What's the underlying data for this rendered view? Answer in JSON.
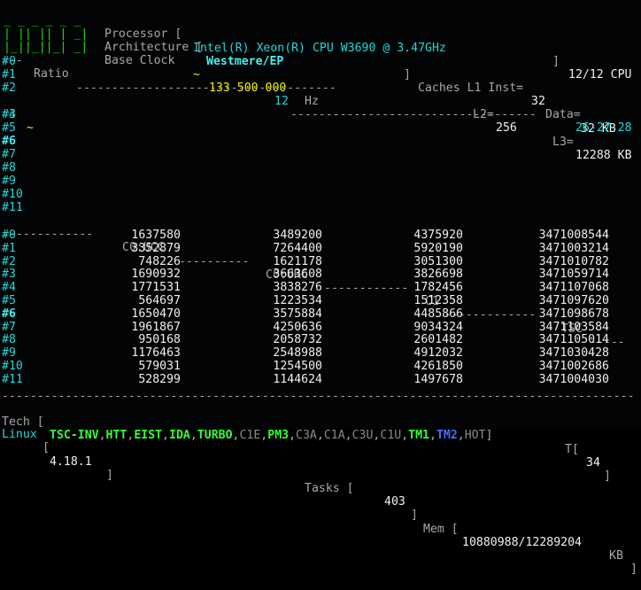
{
  "header": {
    "logo_lines": [
      "_ _ _ _ _ _",
      "| || || | _|",
      "|_||_||_| _|"
    ],
    "processor_label": "Processor [",
    "processor_value": "Intel(R) Xeon(R) CPU W3690 @ 3.47GHz",
    "processor_close": "]",
    "cpu_count": "12/12 CPU",
    "arch_label": "Architecture [",
    "arch_value": "Westmere/EP",
    "arch_close": "]",
    "caches_label": "Caches L1 Inst=",
    "l1_inst": "32",
    "data_label": "Data=",
    "l1_data": "32 KB",
    "base_clock_label": "Base Clock",
    "base_clock_tilde": "~",
    "base_clock_value": "133 500 000",
    "base_clock_unit": "Hz",
    "l2_label": "L2=",
    "l2_value": "256",
    "l3_label": "L3=",
    "l3_value": "12288 KB"
  },
  "ratio": {
    "label": "Ratio",
    "mid_marker": "12",
    "right_markers": "26-27-28",
    "cores": [
      "#0",
      "#1",
      "#2",
      "#3",
      "#4",
      "#5",
      "#6",
      "#7",
      "#8",
      "#9",
      "#10",
      "#11"
    ],
    "core3_marker": "~"
  },
  "table": {
    "columns": [
      "C0:UCC",
      "C0:URC",
      "C1",
      "TSC"
    ],
    "rows": [
      {
        "core": "#0",
        "ucc": "1637580",
        "urc": "3489200",
        "c1": "4375920",
        "tsc": "3471008544"
      },
      {
        "core": "#1",
        "ucc": "3352879",
        "urc": "7264400",
        "c1": "5920190",
        "tsc": "3471003214"
      },
      {
        "core": "#2",
        "ucc": "748226",
        "urc": "1621178",
        "c1": "3051300",
        "tsc": "3471010782"
      },
      {
        "core": "#3",
        "ucc": "1690932",
        "urc": "3663608",
        "c1": "3826698",
        "tsc": "3471059714"
      },
      {
        "core": "#4",
        "ucc": "1771531",
        "urc": "3838276",
        "c1": "1782456",
        "tsc": "3471107068"
      },
      {
        "core": "#5",
        "ucc": "564697",
        "urc": "1223534",
        "c1": "1512358",
        "tsc": "3471097620"
      },
      {
        "core": "#6",
        "ucc": "1650470",
        "urc": "3575884",
        "c1": "4485866",
        "tsc": "3471098678"
      },
      {
        "core": "#7",
        "ucc": "1961867",
        "urc": "4250636",
        "c1": "9034324",
        "tsc": "3471103584"
      },
      {
        "core": "#8",
        "ucc": "950168",
        "urc": "2058732",
        "c1": "2601482",
        "tsc": "3471105014"
      },
      {
        "core": "#9",
        "ucc": "1176463",
        "urc": "2548988",
        "c1": "4912032",
        "tsc": "3471030428"
      },
      {
        "core": "#10",
        "ucc": "579031",
        "urc": "1254500",
        "c1": "4261850",
        "tsc": "3471002686"
      },
      {
        "core": "#11",
        "ucc": "528299",
        "urc": "1144624",
        "c1": "1497678",
        "tsc": "3471004030"
      }
    ]
  },
  "tech": {
    "label": "Tech [",
    "flags": [
      {
        "text": "TSC-INV",
        "state": "on"
      },
      {
        "text": "HTT",
        "state": "on"
      },
      {
        "text": "EIST",
        "state": "on"
      },
      {
        "text": "IDA",
        "state": "on"
      },
      {
        "text": "TURBO",
        "state": "on"
      },
      {
        "text": "C1E",
        "state": "off"
      },
      {
        "text": "PM3",
        "state": "on"
      },
      {
        "text": "C3A",
        "state": "off"
      },
      {
        "text": "C1A",
        "state": "off"
      },
      {
        "text": "C3U",
        "state": "off"
      },
      {
        "text": "C1U",
        "state": "off"
      },
      {
        "text": "TM1",
        "state": "on"
      },
      {
        "text": "TM2",
        "state": "blue"
      },
      {
        "text": "HOT",
        "state": "off"
      }
    ],
    "close": "]",
    "temp_label": "T[",
    "temp_value": "34",
    "temp_close": "]"
  },
  "status": {
    "os_label": "Linux",
    "kernel_open": "[",
    "kernel": "4.18.1",
    "kernel_close": "]",
    "tasks_label": "Tasks [",
    "tasks_value": "403",
    "tasks_close": "]",
    "mem_label": "Mem [",
    "mem_value": "10880988/12289204",
    "mem_unit": "KB",
    "mem_close": "]",
    "accent_cyan": "#22d8d8",
    "accent_green": "#10e010",
    "accent_yellow": "#f0f000"
  }
}
